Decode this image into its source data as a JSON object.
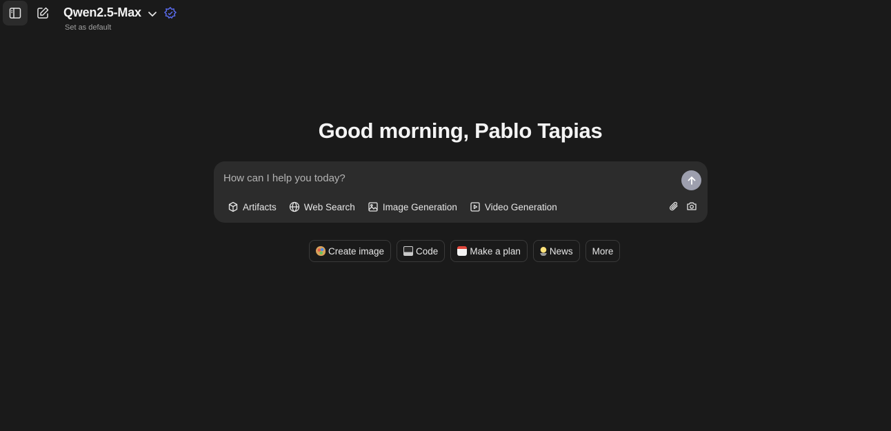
{
  "header": {
    "model_name": "Qwen2.5-Max",
    "set_default": "Set as default"
  },
  "main": {
    "greeting": "Good morning, Pablo Tapias",
    "composer": {
      "placeholder": "How can I help you today?",
      "value": ""
    },
    "tools": [
      {
        "label": "Artifacts",
        "icon": "cube-icon"
      },
      {
        "label": "Web Search",
        "icon": "globe-icon"
      },
      {
        "label": "Image Generation",
        "icon": "image-icon"
      },
      {
        "label": "Video Generation",
        "icon": "video-icon"
      }
    ],
    "chips": [
      {
        "label": "Create image",
        "icon": "palette-icon"
      },
      {
        "label": "Code",
        "icon": "laptop-icon"
      },
      {
        "label": "Make a plan",
        "icon": "calendar-icon"
      },
      {
        "label": "News",
        "icon": "lightbulb-icon"
      },
      {
        "label": "More",
        "icon": ""
      }
    ]
  },
  "colors": {
    "background": "#1a1a1a",
    "composer": "#2c2c2c",
    "send_button": "#9d9fae",
    "badge_accent": "#5b6cf0"
  }
}
